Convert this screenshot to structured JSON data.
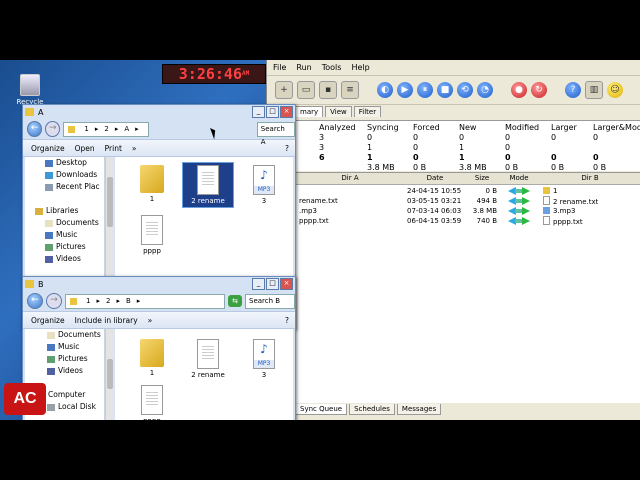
{
  "desktop": {
    "recycle_label": "Recycle Bin"
  },
  "app": {
    "menu": [
      "File",
      "Run",
      "Tools",
      "Help"
    ],
    "tabs": [
      "mary",
      "View",
      "Filter"
    ],
    "summary": {
      "columns": [
        "Analyzed",
        "Syncing",
        "Forced",
        "New",
        "Modified",
        "Larger",
        "Larger&Modif"
      ],
      "rows": [
        [
          "3",
          "0",
          "0",
          "0",
          "0",
          "0",
          "0"
        ],
        [
          "3",
          "1",
          "0",
          "1",
          "0",
          "",
          ""
        ],
        [
          "6",
          "1",
          "0",
          "1",
          "0",
          "0",
          "0"
        ],
        [
          "",
          "3.8 MB",
          "0 B",
          "3.8 MB",
          "0 B",
          "0 B",
          "0 B"
        ]
      ]
    },
    "grid": {
      "headers": [
        "Dir A",
        "Date",
        "Size",
        "Mode",
        "Dir B"
      ],
      "rows": [
        {
          "dir_a": "",
          "date": "24-04-15 10:55",
          "size": "0 B",
          "dir_b": "1",
          "b_icon": "folder"
        },
        {
          "dir_a": "rename.txt",
          "date": "03-05-15 03:21",
          "size": "494 B",
          "dir_b": "2 rename.txt",
          "b_icon": "doc"
        },
        {
          "dir_a": ".mp3",
          "date": "07-03-14 06:03",
          "size": "3.8 MB",
          "dir_b": "3.mp3",
          "b_icon": "mp3"
        },
        {
          "dir_a": "pppp.txt",
          "date": "06-04-15 03:59",
          "size": "740 B",
          "dir_b": "pppp.txt",
          "b_icon": "doc"
        }
      ]
    },
    "bottom_tabs": [
      "Sync Queue",
      "Schedules",
      "Messages"
    ]
  },
  "win_a": {
    "title": "A",
    "path": [
      "1",
      "2",
      "A"
    ],
    "search": "Search A",
    "commands": [
      "Organize",
      "Open",
      "Print",
      "»"
    ],
    "nav": [
      {
        "label": "Desktop",
        "icon": "desktop-icon"
      },
      {
        "label": "Downloads",
        "icon": "downloads-icon"
      },
      {
        "label": "Recent Plac",
        "icon": "recent-places-icon"
      },
      {
        "label": "",
        "icon": ""
      },
      {
        "label": "Libraries",
        "icon": "libraries-icon"
      },
      {
        "label": "Documents",
        "icon": "documents-icon"
      },
      {
        "label": "Music",
        "icon": "music-icon"
      },
      {
        "label": "Pictures",
        "icon": "pictures-icon"
      },
      {
        "label": "Videos",
        "icon": "videos-icon"
      }
    ],
    "files": [
      {
        "label": "1",
        "type": "folder"
      },
      {
        "label": "2 rename",
        "type": "doc"
      },
      {
        "label": "3",
        "type": "mp3"
      },
      {
        "label": "pppp",
        "type": "doc"
      }
    ]
  },
  "win_b": {
    "title": "B",
    "path": [
      "1",
      "2",
      "B"
    ],
    "search": "Search B",
    "commands": [
      "Organize",
      "Include in library",
      "»"
    ],
    "nav": [
      {
        "label": "Documents",
        "icon": "documents-icon"
      },
      {
        "label": "Music",
        "icon": "music-icon"
      },
      {
        "label": "Pictures",
        "icon": "pictures-icon"
      },
      {
        "label": "Videos",
        "icon": "videos-icon"
      },
      {
        "label": "",
        "icon": ""
      },
      {
        "label": "Computer",
        "icon": "computer-icon"
      },
      {
        "label": "Local Disk",
        "icon": "disk-icon"
      }
    ],
    "files": [
      {
        "label": "1",
        "type": "folder"
      },
      {
        "label": "2 rename",
        "type": "doc"
      },
      {
        "label": "3",
        "type": "mp3"
      },
      {
        "label": "pppp",
        "type": "doc"
      }
    ]
  },
  "clock": {
    "time": "3:26:46",
    "ampm": "AM"
  },
  "logo": {
    "text": "AC"
  },
  "mp3_tag": "MP3"
}
